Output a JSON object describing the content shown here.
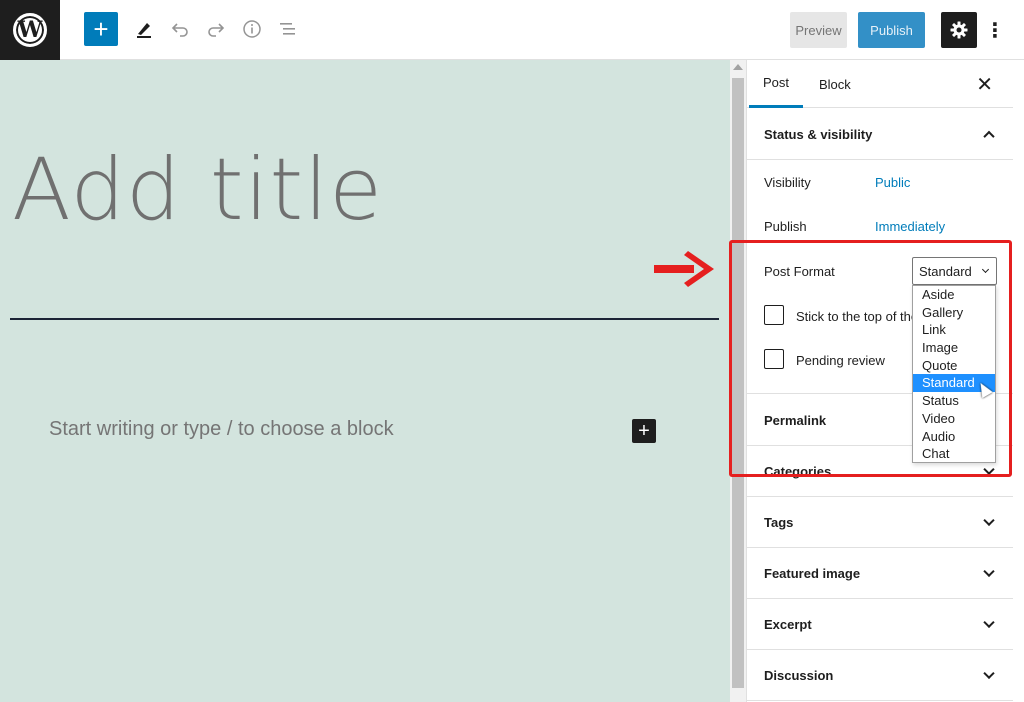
{
  "topbar": {
    "logo_letter": "W",
    "add_block_symbol": "+",
    "preview_label": "Preview",
    "publish_label": "Publish",
    "more_symbol": "⋮"
  },
  "editor": {
    "title_placeholder": "Add title",
    "appender_text": "Start writing or type / to choose a block",
    "inline_add_symbol": "+"
  },
  "sidebar": {
    "tabs": [
      {
        "label": "Post"
      },
      {
        "label": "Block"
      }
    ],
    "close_symbol": "✕",
    "status_visibility": {
      "title": "Status & visibility",
      "visibility_label": "Visibility",
      "visibility_value": "Public",
      "publish_label": "Publish",
      "publish_value": "Immediately",
      "post_format_label": "Post Format",
      "post_format_value": "Standard",
      "stick_label": "Stick to the top of the blog",
      "pending_label": "Pending review"
    },
    "panels": [
      {
        "title": "Permalink"
      },
      {
        "title": "Categories"
      },
      {
        "title": "Tags"
      },
      {
        "title": "Featured image"
      },
      {
        "title": "Excerpt"
      },
      {
        "title": "Discussion"
      }
    ]
  },
  "post_format_options": [
    "Aside",
    "Gallery",
    "Link",
    "Image",
    "Quote",
    "Standard",
    "Status",
    "Video",
    "Audio",
    "Chat"
  ],
  "post_format_selected": "Standard",
  "colors": {
    "accent": "#007cba",
    "canvas_bg": "#d3e4de",
    "annotation_red": "#e51f1f",
    "dropdown_highlight": "#1e90ff"
  }
}
